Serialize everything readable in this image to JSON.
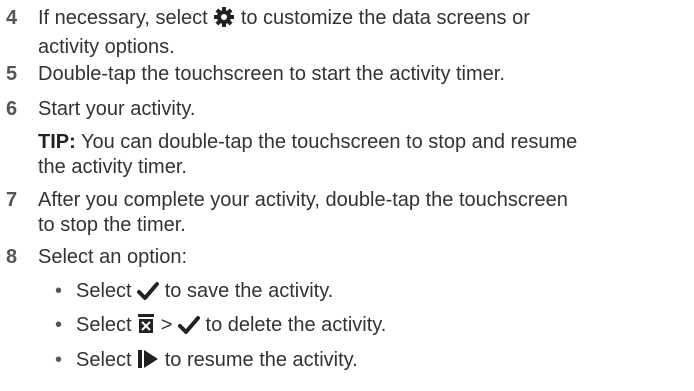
{
  "steps": [
    {
      "num": "4",
      "pre": "If necessary, select ",
      "icon": "gear-icon",
      "post": " to customize the data screens or",
      "cont": "activity options."
    },
    {
      "num": "5",
      "text": "Double-tap the touchscreen to start the activity timer."
    },
    {
      "num": "6",
      "text": "Start your activity.",
      "tip_label": "TIP:",
      "tip_text": " You can double-tap the touchscreen to stop and resume",
      "tip_cont": "the activity timer."
    },
    {
      "num": "7",
      "text": "After you complete your activity, double-tap the touchscreen",
      "cont": "to stop the timer."
    },
    {
      "num": "8",
      "text": "Select an option:"
    }
  ],
  "options": [
    {
      "bullet": "•",
      "pre": "Select ",
      "icon": "checkmark-icon",
      "post": " to save the activity."
    },
    {
      "bullet": "•",
      "pre": "Select ",
      "icon": "discard-icon",
      "mid": " > ",
      "icon2": "checkmark-icon",
      "post": " to delete the activity."
    },
    {
      "bullet": "•",
      "pre": "Select ",
      "icon": "play-icon",
      "post": " to resume the activity."
    }
  ]
}
